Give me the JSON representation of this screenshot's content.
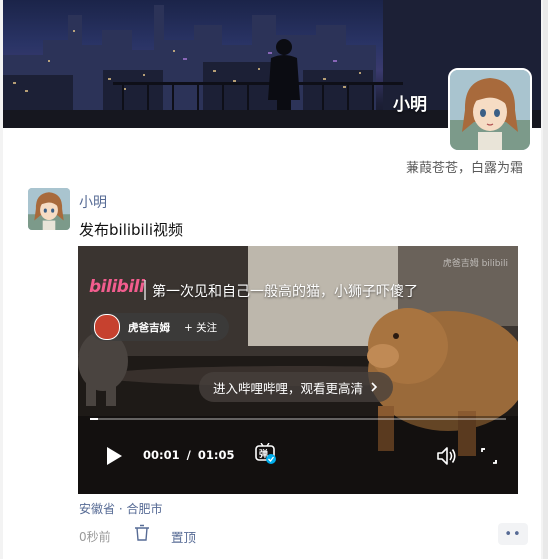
{
  "profile": {
    "name": "小明",
    "signature": "蒹葭苍苍，白露为霜"
  },
  "post": {
    "username": "小明",
    "text": "发布bilibili视频",
    "video": {
      "logo": "bilibili",
      "title": "第一次见和自己一般高的猫，小狮子吓傻了",
      "watermark": "虎爸吉姆 bilibili",
      "uploader": "虎爸吉姆",
      "follow_label": "+ 关注",
      "open_label": "进入哔哩哔哩，观看更高清",
      "current_time": "00:01",
      "separator": "/",
      "duration": "01:05",
      "progress": 0.02,
      "danmaku_label": "弹"
    },
    "location": "安徽省 · 合肥市",
    "time": "0秒前",
    "pin_label": "置顶",
    "more_label": "••"
  },
  "colors": {
    "link": "#576b95",
    "bilibili": "#f25d8e"
  },
  "icons": [
    "play-icon",
    "danmaku-icon",
    "volume-icon",
    "fullscreen-icon",
    "delete-icon",
    "more-icon"
  ]
}
